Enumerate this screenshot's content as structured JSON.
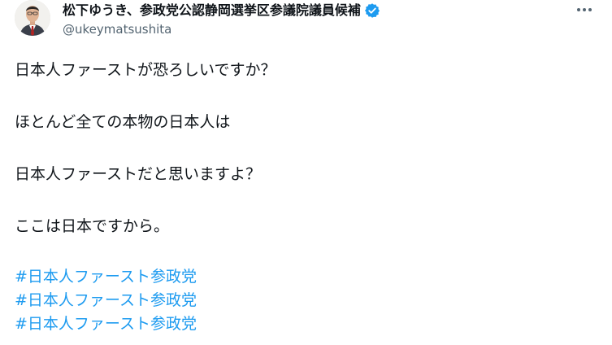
{
  "user": {
    "display_name": "松下ゆうき、参政党公認静岡選挙区参議院議員候補",
    "handle": "@ukeymatsushita",
    "verified_icon": "verified-badge-icon",
    "badge_color": "#1d9bf0"
  },
  "menu": {
    "icon": "more-options-icon"
  },
  "tweet": {
    "paragraphs": [
      "日本人ファーストが恐ろしいですか？",
      "ほとんど全ての本物の日本人は",
      "日本人ファーストだと思いますよ？",
      "ここは日本ですから。"
    ],
    "hashtags": [
      "#日本人ファースト参政党",
      "#日本人ファースト参政党",
      "#日本人ファースト参政党"
    ],
    "link_color": "#1d9bf0"
  }
}
